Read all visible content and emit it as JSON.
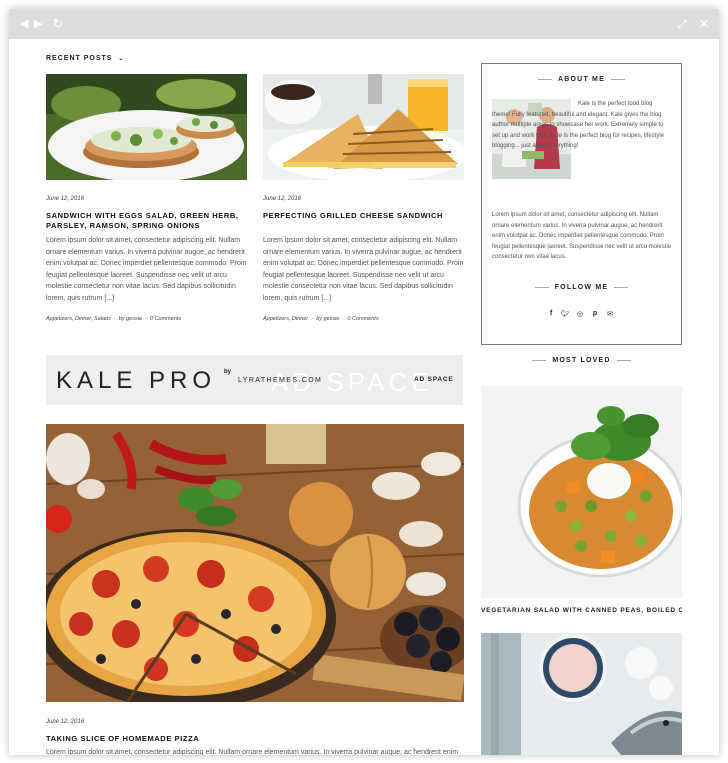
{
  "recent_posts": {
    "heading": "Recent Posts",
    "posts": [
      {
        "date": "June 12, 2016",
        "title": "Sandwich with eggs salad, green herb, parsley, ramson, spring onions",
        "excerpt": "Lorem ipsum dolor sit amet, consectetur adipiscing elit. Nullam ornare elementum varius. In viverra pulvinar augue, ac hendrerit enim volutpat ac. Donec imperdiet pellentesque commodo. Proin feugiat pellentesque laoreet. Suspendisse nec velit ut arcu molestie consectetur non vitae lacus. Sed dapibus sollicitudin lorem, quis rutrum [...]",
        "categories": "Appetizers, Dinner, Salads",
        "author": "by gessie",
        "comments": "0 Comments"
      },
      {
        "date": "June 12, 2016",
        "title": "Perfecting Grilled Cheese Sandwich",
        "excerpt": "Lorem ipsum dolor sit amet, consectetur adipiscing elit. Nullam ornare elementum varius. In viverra pulvinar augue, ac hendrerit enim volutpat ac. Donec imperdiet pellentesque commodo. Proin feugiat pellentesque laoreet. Suspendisse nec velit ut arcu molestie consectetur non vitae lacus. Sed dapibus sollicitudin lorem, quis rutrum [...]",
        "categories": "Appetizers, Dinner",
        "author": "by gessie",
        "comments": "0 Comments"
      }
    ]
  },
  "ad": {
    "brand": "KALE PRO",
    "by": "by",
    "company": "LYRATHEMES.COM",
    "watermark": "AD SPACE",
    "label": "AD SPACE"
  },
  "featured_post": {
    "date": "June 12, 2016",
    "title": "Taking Slice of Homemade Pizza",
    "excerpt": "Lorem ipsum dolor sit amet, consectetur adipiscing elit. Nullam ornare elementum varius. In viverra pulvinar augue, ac hendrerit enim"
  },
  "about": {
    "title": "About Me",
    "intro": "Kale is the perfect food blog theme! Fully featured, beautiful and elegant. Kale gives the blog author multiple areas to showcase her work. Extremely simple to set up and work with, Kale is the perfect blog for recipes, lifestyle blogging... just about everything!",
    "body": "Lorem ipsum dolor sit amet, consectetur adipiscing elit. Nullam ornare elementum varius. In viverra pulvinar augue, ac hendrerit enim volutpat ac. Donec imperdiet pellentesque commodo. Proin feugiat pellentesque laoreet. Suspendisse nec velit ut arcu molestie consectetur non vitae lacus.",
    "follow_title": "Follow Me",
    "social_icons": [
      "facebook-icon",
      "twitter-icon",
      "instagram-icon",
      "pinterest-icon",
      "email-icon"
    ]
  },
  "most_loved": {
    "title": "Most Loved",
    "items": [
      {
        "caption": "Vegetarian salad with canned peas, boiled ca..."
      }
    ]
  },
  "colors": {
    "chrome": "#dcdcdc",
    "ad_background": "#eeeeee",
    "border": "#777777",
    "text": "#333333"
  }
}
